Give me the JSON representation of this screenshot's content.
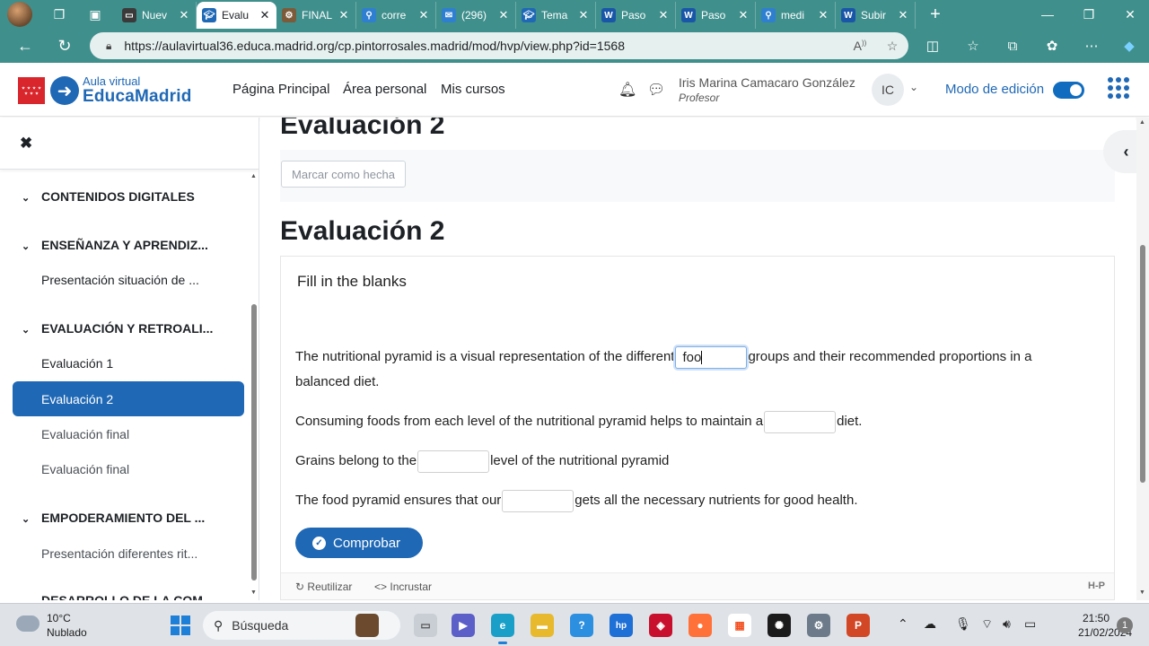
{
  "browser": {
    "tabs": [
      {
        "label": "Nuev",
        "fav_color": "#3a3a3a",
        "fav_icon": "window-icon"
      },
      {
        "label": "Evalu",
        "fav_color": "#1f68b5",
        "fav_icon": "graduation-cap-icon",
        "active": true
      },
      {
        "label": "FINAL",
        "fav_color": "#7b5b3a",
        "fav_icon": "gear-icon"
      },
      {
        "label": "corre",
        "fav_color": "#2f7fd1",
        "fav_icon": "search-icon"
      },
      {
        "label": "(296)",
        "fav_color": "#2f7fd1",
        "fav_icon": "mail-icon"
      },
      {
        "label": "Tema",
        "fav_color": "#1f68b5",
        "fav_icon": "graduation-cap-icon"
      },
      {
        "label": "Paso",
        "fav_color": "#1a56a8",
        "fav_icon": "word-icon"
      },
      {
        "label": "Paso",
        "fav_color": "#1a56a8",
        "fav_icon": "word-icon"
      },
      {
        "label": "medi",
        "fav_color": "#2f7fd1",
        "fav_icon": "search-icon"
      },
      {
        "label": "Subir",
        "fav_color": "#1a56a8",
        "fav_icon": "word-icon"
      }
    ],
    "url": "https://aulavirtual36.educa.madrid.org/cp.pintorrosales.madrid/mod/hvp/view.php?id=1568"
  },
  "site": {
    "logo_small": "Aula virtual",
    "logo_big": "EducaMadrid",
    "nav": [
      "Página Principal",
      "Área personal",
      "Mis cursos"
    ],
    "user_name": "Iris Marina Camacaro González",
    "user_role": "Profesor",
    "avatar_initials": "IC",
    "edit_mode_label": "Modo de edición",
    "edit_mode_on": true,
    "accent_color": "#1f68b5"
  },
  "drawer": {
    "sections": [
      {
        "title": "CONTENIDOS DIGITALES",
        "items": []
      },
      {
        "title": "ENSEÑANZA Y APRENDIZ...",
        "items": [
          "Presentación situación de ..."
        ]
      },
      {
        "title": "EVALUACIÓN Y RETROALI...",
        "items": [
          "Evaluación 1",
          "Evaluación 2",
          "Evaluación final",
          "Evaluación final"
        ]
      },
      {
        "title": "EMPODERAMIENTO DEL ...",
        "items": [
          "Presentación diferentes rit..."
        ]
      },
      {
        "title": "DESARROLLO DE LA COM...",
        "items": []
      }
    ],
    "active_item": "Evaluación 2"
  },
  "main": {
    "top_title": "Evaluación 2",
    "mark_done_label": "Marcar como hecha",
    "page_title": "Evaluación 2",
    "activity": {
      "heading": "Fill in the blanks",
      "sentences": [
        {
          "before": "The nutritional pyramid is a visual representation of the different",
          "blank_value": "foo",
          "after": "groups and their recommended proportions in a",
          "continuation": "balanced diet."
        },
        {
          "before": "Consuming foods from each level of the nutritional pyramid helps to maintain a",
          "blank_value": "",
          "after": "diet."
        },
        {
          "before": "Grains belong to the",
          "blank_value": "",
          "after": "level of the nutritional pyramid"
        },
        {
          "before": "The food pyramid ensures that our",
          "blank_value": "",
          "after": "gets all the necessary nutrients for good health."
        }
      ],
      "check_label": "Comprobar",
      "reuse_label": "Reutilizar",
      "embed_label": "Incrustar",
      "h5p_mark": "H-P"
    }
  },
  "taskbar": {
    "temperature": "10°C",
    "weather": "Nublado",
    "search_label": "Búsqueda",
    "time": "21:50",
    "date": "21/02/2024",
    "notifications": "1"
  }
}
